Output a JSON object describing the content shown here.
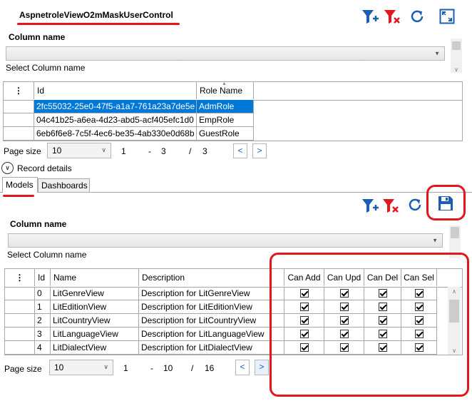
{
  "window": {
    "title": "AspnetroleViewO2mMaskUserControl"
  },
  "top_filter": {
    "label": "Column name",
    "placeholder": "Select Column name",
    "selected": ""
  },
  "top_grid": {
    "columns": [
      "Id",
      "Role Name"
    ],
    "menu_glyph": "⋮",
    "sort_glyph": "▲",
    "rows": [
      {
        "id": "2fc55032-25e0-47f5-a1a7-761a23a7de5e",
        "role": "AdmRole",
        "selected": true
      },
      {
        "id": "04c41b25-a6ea-4d23-abd5-acf405efc1d0",
        "role": "EmpRole",
        "selected": false
      },
      {
        "id": "6eb6f6e8-7c5f-4ec6-be35-4ab330e0d68b",
        "role": "GuestRole",
        "selected": false
      }
    ]
  },
  "top_pager": {
    "label": "Page size",
    "size": "10",
    "from": "1",
    "dash": "-",
    "to": "3",
    "slash": "/",
    "total": "3",
    "prev": "<",
    "next": ">"
  },
  "record_details": {
    "label": "Record details"
  },
  "tabs": [
    {
      "label": "Models",
      "active": true
    },
    {
      "label": "Dashboards",
      "active": false
    }
  ],
  "bottom_filter": {
    "label": "Column name",
    "placeholder": "Select Column name",
    "selected": ""
  },
  "bottom_grid": {
    "columns": [
      "Id",
      "Name",
      "Description",
      "Can Add",
      "Can Upd",
      "Can Del",
      "Can Sel"
    ],
    "menu_glyph": "⋮",
    "rows": [
      {
        "id": "0",
        "name": "LitGenreView",
        "description": "Description for LitGenreView",
        "add": true,
        "upd": true,
        "del": true,
        "sel": true
      },
      {
        "id": "1",
        "name": "LitEditionView",
        "description": "Description for LitEditionView",
        "add": true,
        "upd": true,
        "del": true,
        "sel": true
      },
      {
        "id": "2",
        "name": "LitCountryView",
        "description": "Description for LitCountryView",
        "add": true,
        "upd": true,
        "del": true,
        "sel": true
      },
      {
        "id": "3",
        "name": "LitLanguageView",
        "description": "Description for LitLanguageView",
        "add": true,
        "upd": true,
        "del": true,
        "sel": true
      },
      {
        "id": "4",
        "name": "LitDialectView",
        "description": "Description for LitDialectView",
        "add": true,
        "upd": true,
        "del": true,
        "sel": true
      }
    ]
  },
  "bottom_pager": {
    "label": "Page size",
    "size": "10",
    "from": "1",
    "dash": "-",
    "to": "10",
    "slash": "/",
    "total": "16",
    "prev": "<",
    "next": ">"
  },
  "colors": {
    "accent": "#1a5fb4",
    "danger": "#e3161e",
    "selection": "#0078d7"
  },
  "icons": [
    "filter-add-icon",
    "filter-clear-icon",
    "refresh-icon",
    "maximize-icon",
    "save-icon",
    "chevron-down-icon"
  ]
}
